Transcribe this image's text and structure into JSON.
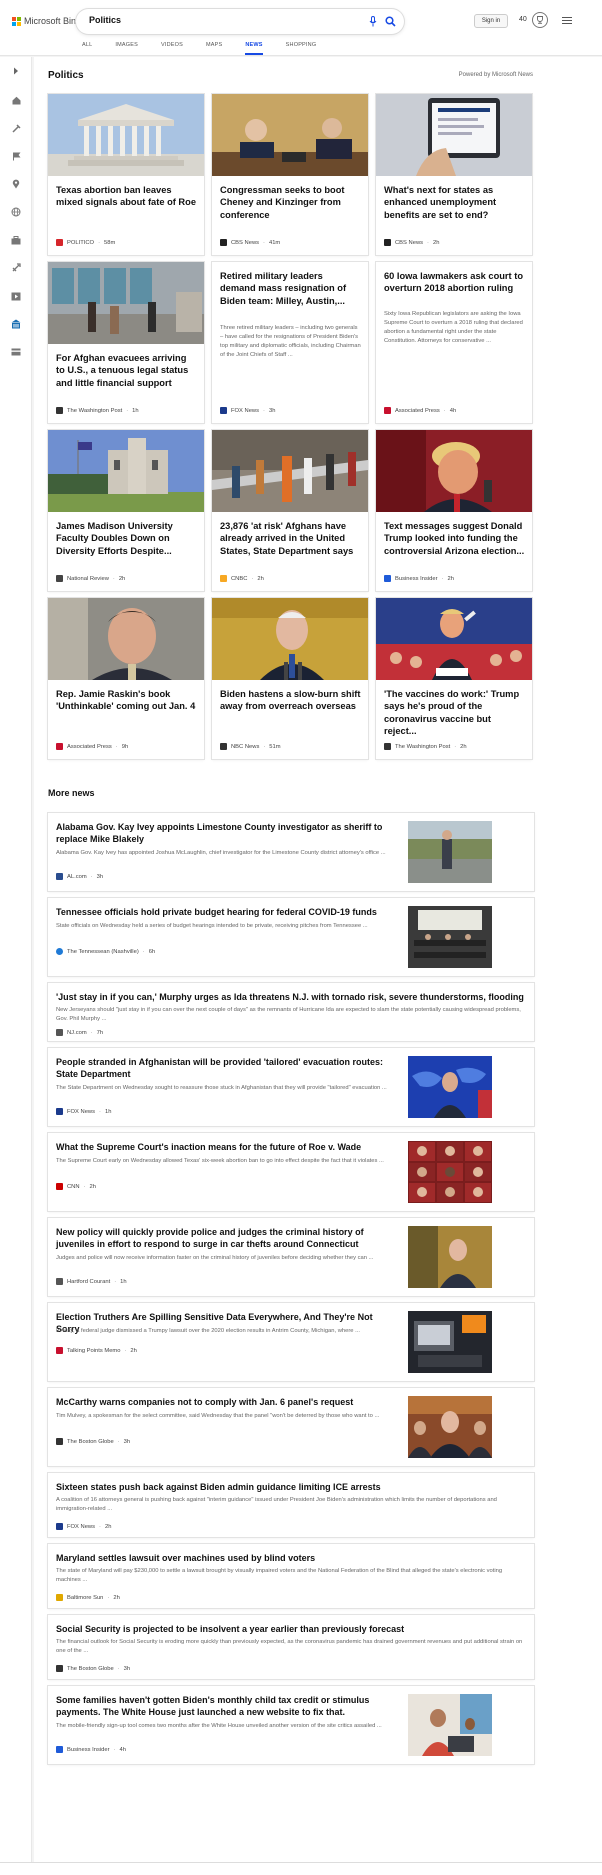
{
  "header": {
    "logo_text": "Microsoft Bing",
    "search_value": "Politics",
    "signin_label": "Sign in",
    "points": "40",
    "tabs": [
      "ALL",
      "IMAGES",
      "VIDEOS",
      "MAPS",
      "NEWS",
      "SHOPPING"
    ],
    "active_tab": "NEWS"
  },
  "page": {
    "title": "Politics",
    "powered_by": "Powered by Microsoft News"
  },
  "cards": [
    {
      "title": "Texas abortion ban leaves mixed signals about fate of Roe",
      "snippet": "",
      "source": "POLITICO",
      "time": "58m",
      "logo_color": "#d6262b"
    },
    {
      "title": "Congressman seeks to boot Cheney and Kinzinger from conference",
      "snippet": "",
      "source": "CBS News",
      "time": "41m",
      "logo_color": "#222222"
    },
    {
      "title": "What's next for states as enhanced unemployment benefits are set to end?",
      "snippet": "",
      "source": "CBS News",
      "time": "2h",
      "logo_color": "#222222"
    },
    {
      "title": "For Afghan evacuees arriving to U.S., a tenuous legal status and little financial support",
      "snippet": "",
      "source": "The Washington Post",
      "time": "1h",
      "logo_color": "#333333"
    },
    {
      "title": "Retired military leaders demand mass resignation of Biden team: Milley, Austin,...",
      "snippet": "Three retired military leaders – including two generals – have called for the resignations of President Biden's top military and diplomatic officials, including Chairman of the Joint Chiefs of Staff ...",
      "source": "FOX News",
      "time": "3h",
      "logo_color": "#1b3a8c"
    },
    {
      "title": "60 Iowa lawmakers ask court to overturn 2018 abortion ruling",
      "snippet": "Sixty Iowa Republican legislators are asking the Iowa Supreme Court to overturn a 2018 ruling that declared abortion a fundamental right under the state Constitution. Attorneys for conservative ...",
      "source": "Associated Press",
      "time": "4h",
      "logo_color": "#c8102e"
    },
    {
      "title": "James Madison University Faculty Doubles Down on Diversity Efforts Despite...",
      "snippet": "",
      "source": "National Review",
      "time": "2h",
      "logo_color": "#444444"
    },
    {
      "title": "23,876 'at risk' Afghans have already arrived in the United States, State Department says",
      "snippet": "",
      "source": "CNBC",
      "time": "2h",
      "logo_color": "#f7a823"
    },
    {
      "title": "Text messages suggest Donald Trump looked into funding the controversial Arizona election...",
      "snippet": "",
      "source": "Business Insider",
      "time": "2h",
      "logo_color": "#1f5bd8"
    },
    {
      "title": "Rep. Jamie Raskin's book 'Unthinkable' coming out Jan. 4",
      "snippet": "",
      "source": "Associated Press",
      "time": "9h",
      "logo_color": "#c8102e"
    },
    {
      "title": "Biden hastens a slow-burn shift away from overreach overseas",
      "snippet": "",
      "source": "NBC News",
      "time": "51m",
      "logo_color": "#333333"
    },
    {
      "title": "'The vaccines do work:' Trump says he's proud of the coronavirus vaccine but reject...",
      "snippet": "",
      "source": "The Washington Post",
      "time": "2h",
      "logo_color": "#333333"
    }
  ],
  "more_news_title": "More news",
  "more_news": [
    {
      "title": "Alabama Gov. Kay Ivey appoints Limestone County investigator as sheriff to replace Mike Blakely",
      "snippet": "Alabama Gov. Kay Ivey has appointed Joshua McLaughlin, chief investigator for the Limestone County district attorney's office ...",
      "source": "AL.com",
      "time": "3h",
      "has_image": true,
      "logo_color": "#2a4d8f"
    },
    {
      "title": "Tennessee officials hold private budget hearing for federal COVID-19 funds",
      "snippet": "State officials on Wednesday held a series of budget hearings intended to be private, receiving pitches from Tennessee ...",
      "source": "The Tennessean (Nashville)",
      "time": "6h",
      "has_image": true,
      "logo_color": "#1f7ad6"
    },
    {
      "title": "'Just stay in if you can,' Murphy urges as Ida threatens N.J. with tornado risk, severe thunderstorms, flooding",
      "snippet": "New Jerseyans should \"just stay in if you can over the next couple of days\" as the remnants of Hurricane Ida are expected to slam the state potentially causing widespread problems, Gov. Phil Murphy ...",
      "source": "NJ.com",
      "time": "7h",
      "has_image": false,
      "logo_color": "#555555"
    },
    {
      "title": "People stranded in Afghanistan will be provided 'tailored' evacuation routes: State Department",
      "snippet": "The State Department on Wednesday sought to reassure those stuck in Afghanistan that they will provide \"tailored\" evacuation ...",
      "source": "FOX News",
      "time": "1h",
      "has_image": true,
      "logo_color": "#1b3a8c"
    },
    {
      "title": "What the Supreme Court's inaction means for the future of Roe v. Wade",
      "snippet": "The Supreme Court early on Wednesday allowed Texas' six-week abortion ban to go into effect despite the fact that it violates ...",
      "source": "CNN",
      "time": "2h",
      "has_image": true,
      "logo_color": "#cc0000"
    },
    {
      "title": "New policy will quickly provide police and judges the criminal history of juveniles in effort to respond to surge in car thefts around Connecticut",
      "snippet": "Judges and police will now receive information faster on the criminal history of juveniles before deciding whether they can ...",
      "source": "Hartford Courant",
      "time": "1h",
      "has_image": true,
      "logo_color": "#555555"
    },
    {
      "title": "Election Truthers Are Spilling Sensitive Data Everywhere, And They're Not Sorry",
      "snippet": "In May, a federal judge dismissed a Trumpy lawsuit over the 2020 election results in Antrim County, Michigan, where ...",
      "source": "Talking Points Memo",
      "time": "2h",
      "has_image": true,
      "logo_color": "#c8102e"
    },
    {
      "title": "McCarthy warns companies not to comply with Jan. 6 panel's request",
      "snippet": "Tim Mulvey, a spokesman for the select committee, said Wednesday that the panel \"won't be deterred by those who want to ...",
      "source": "The Boston Globe",
      "time": "3h",
      "has_image": true,
      "logo_color": "#333333"
    },
    {
      "title": "Sixteen states push back against Biden admin guidance limiting ICE arrests",
      "snippet": "A coalition of 16 attorneys general is pushing back against \"interim guidance\" issued under President Joe Biden's administration which limits the number of deportations and immigration-related ...",
      "source": "FOX News",
      "time": "2h",
      "has_image": false,
      "logo_color": "#1b3a8c"
    },
    {
      "title": "Maryland settles lawsuit over machines used by blind voters",
      "snippet": "The state of Maryland will pay $230,000 to settle a lawsuit brought by visually impaired voters and the National Federation of the Blind that alleged the state's electronic voting machines ...",
      "source": "Baltimore Sun",
      "time": "2h",
      "has_image": false,
      "logo_color": "#e0a800"
    },
    {
      "title": "Social Security is projected to be insolvent a year earlier than previously forecast",
      "snippet": "The financial outlook for Social Security is eroding more quickly than previously expected, as the coronavirus pandemic has drained government revenues and put additional strain on one of the ...",
      "source": "The Boston Globe",
      "time": "3h",
      "has_image": false,
      "logo_color": "#333333"
    },
    {
      "title": "Some families haven't gotten Biden's monthly child tax credit or stimulus payments. The White House just launched a new website to fix that.",
      "snippet": "The mobile-friendly sign-up tool comes two months after the White House unveiled another version of the site critics assailed ...",
      "source": "Business Insider",
      "time": "4h",
      "has_image": true,
      "logo_color": "#1f5bd8"
    }
  ]
}
